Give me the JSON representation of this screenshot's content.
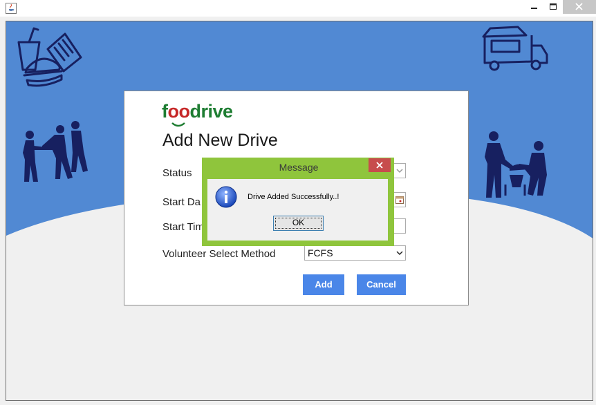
{
  "window": {
    "icons": {
      "app": "java-cup-icon",
      "minimize": "minimize-icon",
      "maximize": "maximize-icon",
      "close": "close-icon"
    }
  },
  "background": {
    "accent_color": "#5189d3",
    "illustration_color": "#172060",
    "icons": [
      "fast-food-icon",
      "food-truck-icon",
      "volunteers-sharing-food-icon",
      "volunteers-serving-food-icon"
    ]
  },
  "form": {
    "logo": {
      "part1": "f",
      "part2": "oo",
      "part3": "drive",
      "green": "#1e7d32",
      "red": "#c62828"
    },
    "title": "Add New Drive",
    "labels": {
      "status": "Status",
      "start_date": "Start Da",
      "start_time": "Start Tim",
      "volunteer_method": "Volunteer Select Method"
    },
    "volunteer_method_value": "FCFS",
    "add_label": "Add",
    "cancel_label": "Cancel",
    "button_color": "#4a86e8"
  },
  "dialog": {
    "title": "Message",
    "message": "Drive Added Successfully..!",
    "ok_label": "OK",
    "frame_color": "#8fc53c",
    "close_color": "#c74c4c",
    "icon": "information-icon"
  }
}
